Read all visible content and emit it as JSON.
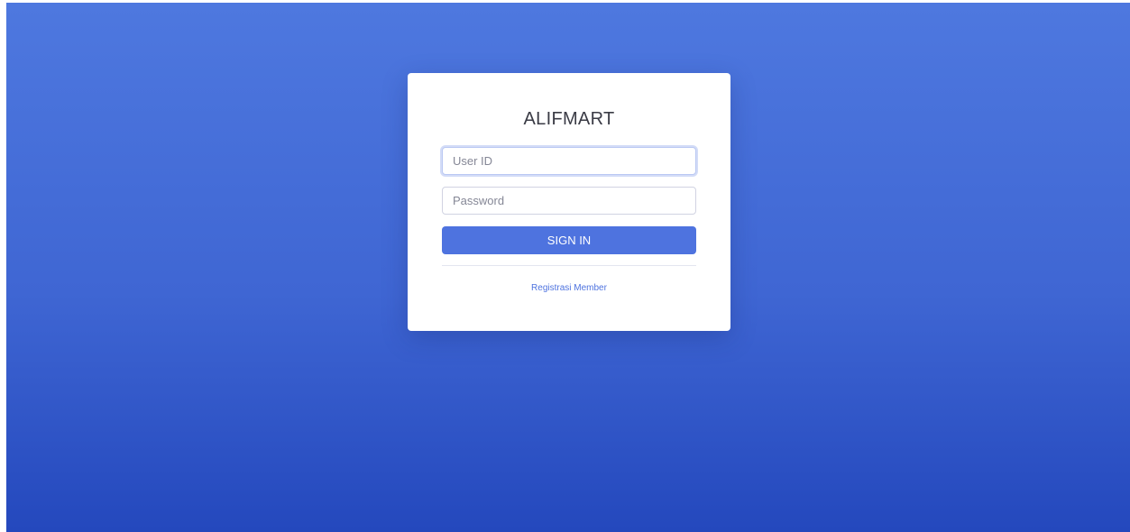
{
  "login": {
    "brand": "ALIFMART",
    "user_id_placeholder": "User ID",
    "password_placeholder": "Password",
    "sign_in_label": "SIGN IN",
    "register_link": "Registrasi Member"
  },
  "colors": {
    "accent": "#4e73df",
    "background_top": "#4e78df",
    "background_bottom": "#2448bd",
    "card": "#ffffff",
    "input_border": "#d1d3e2"
  }
}
